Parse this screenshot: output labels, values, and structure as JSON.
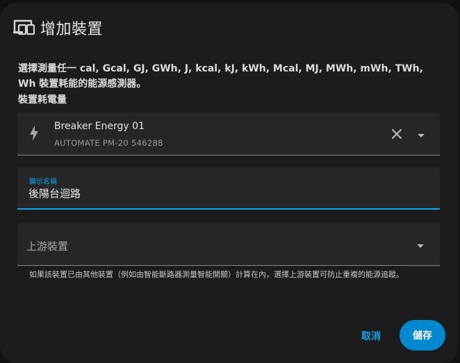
{
  "dialog": {
    "icon": "devices-icon",
    "title": "增加裝置",
    "description": "選擇測量任一 cal, Gcal, GJ, GWh, J, kcal, kJ, kWh, Mcal, MJ, MWh, mWh, TWh, Wh 裝置耗能的能源感測器。",
    "consumption_label": "裝置耗電量"
  },
  "device_field": {
    "icon": "lightning-bolt-icon",
    "name": "Breaker Energy 01",
    "entity": "AUTOMATE PM-20 546288"
  },
  "name_field": {
    "label": "顯示名稱",
    "value": "後陽台迴路"
  },
  "upstream_field": {
    "placeholder": "上游裝置",
    "helper": "如果該裝置已由其他裝置（例如由智能斷路器測量智能開關）計算在內，選擇上游裝置可防止重複的能源追蹤。"
  },
  "buttons": {
    "cancel": "取消",
    "save": "儲存"
  },
  "colors": {
    "accent": "#03a9f4",
    "save_bg": "#0288d1",
    "dialog_bg": "#1c1c1c",
    "field_bg": "#262626"
  }
}
